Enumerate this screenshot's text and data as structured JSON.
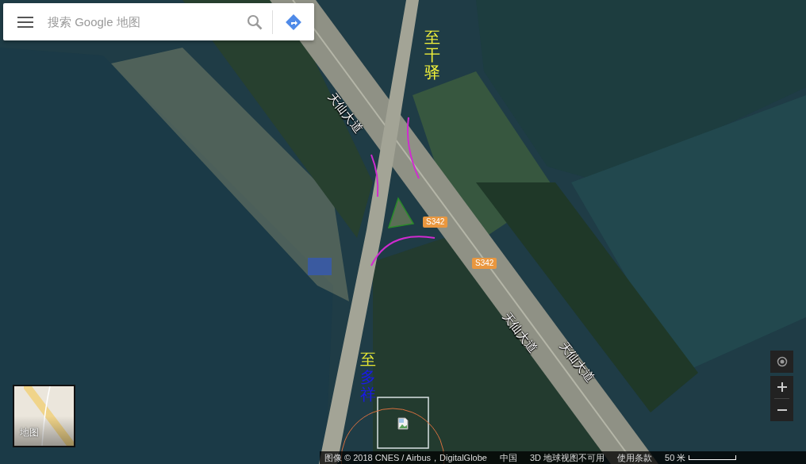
{
  "search": {
    "placeholder": "搜索 Google 地图"
  },
  "map": {
    "road_labels": [
      {
        "text": "天仙大道"
      },
      {
        "text": "天仙大道"
      },
      {
        "text": "天仙大道"
      }
    ],
    "route_shields": [
      "S342",
      "S342"
    ],
    "annotations": [
      {
        "parts": [
          {
            "text": "至干驿",
            "color": "#f2f23a"
          }
        ]
      },
      {
        "parts": [
          {
            "text": "至",
            "color": "#e6e632"
          },
          {
            "text": "多祥",
            "color": "#1a1ae6"
          }
        ]
      }
    ]
  },
  "map_type": {
    "label": "地图"
  },
  "footer": {
    "items": [
      "图像 © 2018 CNES / Airbus，DigitalGlobe",
      "中国",
      "3D 地球视图不可用",
      "使用条款"
    ],
    "scale": "50 米"
  }
}
